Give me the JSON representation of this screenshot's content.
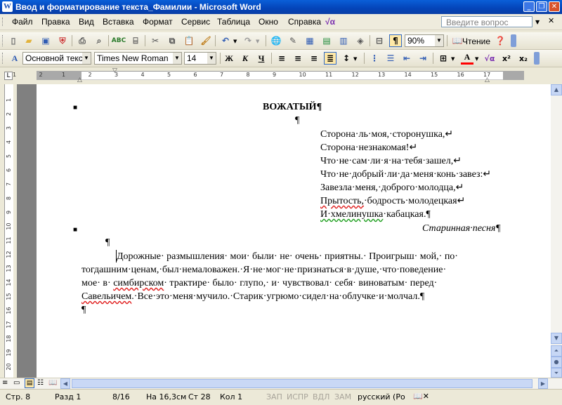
{
  "window": {
    "title": "Ввод и форматирование текста_Фамилии - Microsoft Word"
  },
  "menu": [
    "Файл",
    "Правка",
    "Вид",
    "Вставка",
    "Формат",
    "Сервис",
    "Таблица",
    "Окно",
    "Справка"
  ],
  "ask_placeholder": "Введите вопрос",
  "standard_toolbar": {
    "zoom": "90%",
    "read_label": "Чтение"
  },
  "format_toolbar": {
    "style": "Основной текст",
    "font": "Times New Roman",
    "size": "14"
  },
  "ruler": {
    "numbers": [
      "1",
      "2",
      "1",
      "2",
      "3",
      "4",
      "5",
      "6",
      "7",
      "8",
      "9",
      "10",
      "11",
      "12",
      "13",
      "14",
      "15",
      "16",
      "17"
    ],
    "vnumbers": [
      "1",
      "2",
      "3",
      "4",
      "5",
      "6",
      "7",
      "8",
      "9",
      "10",
      "11",
      "12",
      "13",
      "14",
      "15",
      "16",
      "17",
      "18",
      "19",
      "20"
    ]
  },
  "document": {
    "heading": "ВОЖАТЫЙ¶",
    "empty_para": "¶",
    "poem": [
      {
        "parts": [
          "Сторона·ль·моя,·сторонушка,↵"
        ]
      },
      {
        "parts": [
          "Сторона·незнакомая!↵"
        ]
      },
      {
        "parts": [
          "Что·не·сам·ли·я·на·тебя·зашел,↵"
        ]
      },
      {
        "parts": [
          "Что·не·добрый·ли·да·меня·конь·завез:↵"
        ]
      },
      {
        "parts": [
          "Завезла·меня,·доброго·молодца,↵"
        ]
      },
      {
        "parts": [
          "Прытость,",
          "·бодрость·молодецкая↵"
        ]
      },
      {
        "parts": [
          "И·хмелинушка",
          "·кабацкая.¶"
        ]
      }
    ],
    "attribution": "Старинная·песня¶",
    "para_mark": "¶",
    "prose": [
      "Дорожные· размышления· мои· были· не· очень· приятны.· Проигрыш· мой,· по·",
      "тогдашним·ценам,·был·немаловажен.·Я·не·мог·не·признаться·в·душе,·что·поведение·",
      "мое· в· ",
      "Савельичем",
      "симбирском",
      "· трактире· было· глупо,· и· чувствовал· себя· виноватым· перед·",
      ".·Все·это·меня·мучило.·Старик·угрюмо·сидел·на·облучке·и·молчал.¶"
    ],
    "final_mark": "¶"
  },
  "status": {
    "page": "Стр. 8",
    "section": "Разд 1",
    "pages": "8/16",
    "at": "На 16,3см",
    "line": "Ст 28",
    "col": "Кол 1",
    "rec": "ЗАП",
    "trk": "ИСПР",
    "ext": "ВДЛ",
    "ovr": "ЗАМ",
    "lang": "русский (Ро"
  }
}
